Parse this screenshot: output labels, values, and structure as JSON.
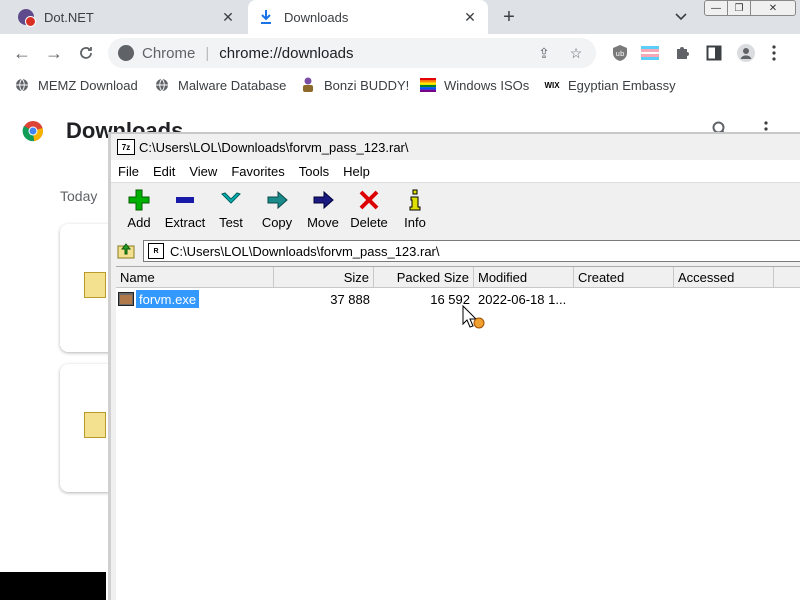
{
  "browser": {
    "tabs": [
      {
        "label": "Dot.NET",
        "active": false
      },
      {
        "label": "Downloads",
        "active": true
      }
    ],
    "omnibox": {
      "label": "Chrome",
      "url": "chrome://downloads"
    },
    "bookmarks": [
      {
        "label": "MEMZ Download",
        "icon": "globe-icon"
      },
      {
        "label": "Malware Database",
        "icon": "globe-icon"
      },
      {
        "label": "Bonzi BUDDY!",
        "icon": "bonzi-icon"
      },
      {
        "label": "Windows ISOs",
        "icon": "rainbow-flag-icon"
      },
      {
        "label": "Egyptian Embassy",
        "icon": "wix-icon"
      }
    ],
    "colors": {
      "tabstrip": "#dee1e6",
      "omnibox": "#f1f3f4"
    }
  },
  "downloads_page": {
    "title": "Downloads",
    "section": "Today"
  },
  "sevenzip": {
    "title": "C:\\Users\\LOL\\Downloads\\forvm_pass_123.rar\\",
    "menu": [
      "File",
      "Edit",
      "View",
      "Favorites",
      "Tools",
      "Help"
    ],
    "toolbar": [
      {
        "label": "Add",
        "icon": "add-icon",
        "color": "#00aa00"
      },
      {
        "label": "Extract",
        "icon": "extract-icon",
        "color": "#1a1aa8"
      },
      {
        "label": "Test",
        "icon": "test-icon",
        "color": "#00aaaa"
      },
      {
        "label": "Copy",
        "icon": "copy-icon",
        "color": "#1a8a8a"
      },
      {
        "label": "Move",
        "icon": "move-icon",
        "color": "#1a1a80"
      },
      {
        "label": "Delete",
        "icon": "delete-icon",
        "color": "#dd0000"
      },
      {
        "label": "Info",
        "icon": "info-icon",
        "color": "#e0e000"
      }
    ],
    "path": "C:\\Users\\LOL\\Downloads\\forvm_pass_123.rar\\",
    "columns": [
      "Name",
      "Size",
      "Packed Size",
      "Modified",
      "Created",
      "Accessed"
    ],
    "files": [
      {
        "name": "forvm.exe",
        "size": "37 888",
        "packed": "16 592",
        "modified": "2022-06-18 1...",
        "created": "",
        "accessed": "",
        "selected": true
      }
    ],
    "selection_color": "#3399ff"
  }
}
